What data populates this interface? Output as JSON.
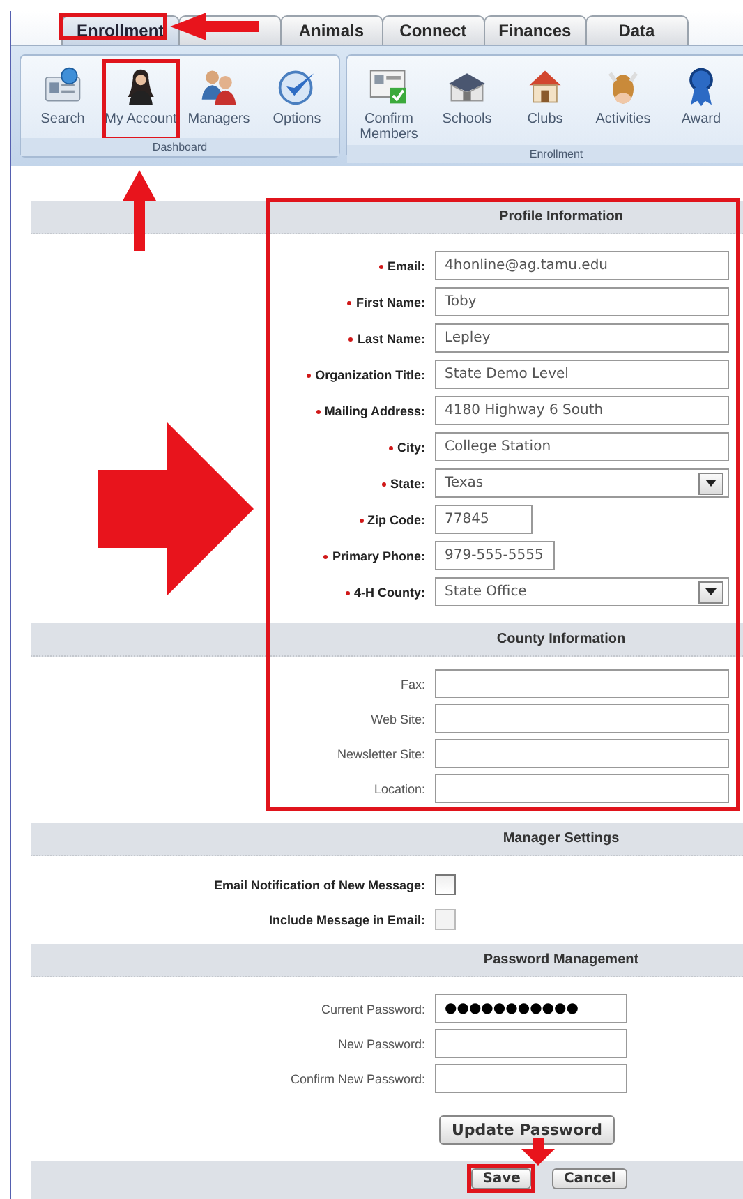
{
  "tabs": [
    {
      "label": "Enrollment",
      "selected": true
    },
    {
      "selected": false
    },
    {
      "label": "Animals",
      "selected": false
    },
    {
      "label": "Connect",
      "selected": false
    },
    {
      "label": "Finances",
      "selected": false
    },
    {
      "label": "Data",
      "selected": false
    }
  ],
  "ribbon": {
    "groups": [
      {
        "label": "Dashboard",
        "items": [
          {
            "label": "Search",
            "selected": false
          },
          {
            "label": "My Account",
            "selected": true
          },
          {
            "label": "Managers",
            "selected": false
          },
          {
            "label": "Options",
            "selected": false
          }
        ]
      },
      {
        "label": "Enrollment",
        "items": [
          {
            "label": "Confirm Members",
            "selected": false
          },
          {
            "label": "Schools",
            "selected": false
          },
          {
            "label": "Clubs",
            "selected": false
          },
          {
            "label": "Activities",
            "selected": false
          },
          {
            "label": "Award",
            "selected": false
          }
        ]
      }
    ]
  },
  "sections": [
    {
      "title": "Profile Information",
      "kind": "required",
      "fields": [
        {
          "label": "Email:",
          "kind": "text",
          "required": true,
          "value": "4honline@ag.tamu.edu"
        },
        {
          "label": "First Name:",
          "kind": "text",
          "required": true,
          "value": "Toby"
        },
        {
          "label": "Last Name:",
          "kind": "text",
          "required": true,
          "value": "Lepley"
        },
        {
          "label": "Organization Title:",
          "kind": "text",
          "required": true,
          "value": "State Demo Level"
        },
        {
          "label": "Mailing Address:",
          "kind": "text",
          "required": true,
          "value": "4180 Highway 6 South"
        },
        {
          "label": "City:",
          "kind": "text",
          "required": true,
          "value": "College Station"
        },
        {
          "label": "State:",
          "kind": "select",
          "required": true,
          "value": "Texas"
        },
        {
          "label": "Zip Code:",
          "kind": "text",
          "required": true,
          "value": "77845"
        },
        {
          "label": "Primary Phone:",
          "kind": "text",
          "required": true,
          "value": "979-555-5555"
        },
        {
          "label": "4-H County:",
          "kind": "select",
          "required": true,
          "value": "State Office"
        }
      ]
    },
    {
      "title": "County Information",
      "kind": "optional",
      "fields": [
        {
          "label": "Fax:",
          "kind": "text",
          "required": false
        },
        {
          "label": "Web Site:",
          "kind": "text",
          "required": false
        },
        {
          "label": "Newsletter Site:",
          "kind": "text",
          "required": false
        },
        {
          "label": "Location:",
          "kind": "text",
          "required": false
        }
      ]
    },
    {
      "title": "Manager Settings",
      "kind": "settings",
      "fields": [
        {
          "label": "Email Notification of New Message:",
          "kind": "checkbox",
          "checked": false,
          "disabled": false
        },
        {
          "label": "Include Message in Email:",
          "kind": "checkbox",
          "checked": false,
          "disabled": true
        }
      ]
    },
    {
      "title": "Password Management",
      "kind": "optional",
      "fields": [
        {
          "label": "Current Password:",
          "kind": "text",
          "value": "●●●●●●●●●●●"
        },
        {
          "label": "New Password:",
          "kind": "text"
        },
        {
          "label": "Confirm New Password:",
          "kind": "text"
        }
      ],
      "button": "Update Password"
    }
  ],
  "footer": {
    "buttons": [
      "Save",
      "Cancel"
    ]
  }
}
